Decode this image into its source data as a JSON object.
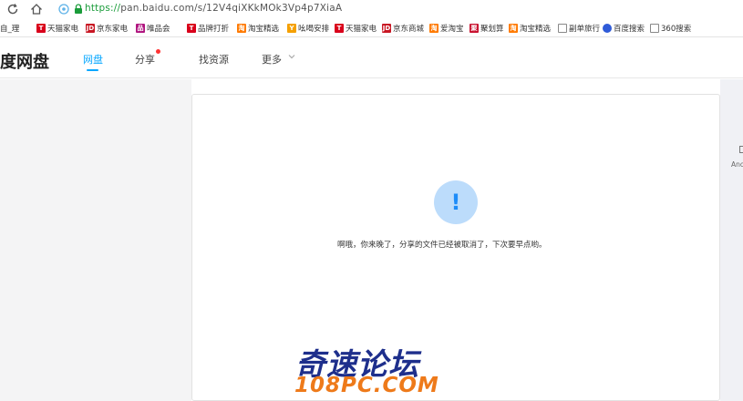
{
  "browser": {
    "url_protocol": "https://",
    "url_rest": "pan.baidu.com/s/12V4qiXKkMOk3Vp4p7XiaA"
  },
  "bookmarks": [
    {
      "label": "自_理",
      "icon": "",
      "color": "#ffffff"
    },
    {
      "label": "天猫家电",
      "icon": "T",
      "color": "#d9001b"
    },
    {
      "label": "京东家电",
      "icon": "JD",
      "color": "#c81623"
    },
    {
      "label": "唯品会",
      "icon": "品",
      "color": "#b0157f"
    },
    {
      "label": "品牌打折",
      "icon": "T",
      "color": "#d9001b"
    },
    {
      "label": "淘宝精选",
      "icon": "淘",
      "color": "#ff7a00"
    },
    {
      "label": "吆喝安排",
      "icon": "Y",
      "color": "#f5a000"
    },
    {
      "label": "天猫家电",
      "icon": "T",
      "color": "#d9001b"
    },
    {
      "label": "京东商城",
      "icon": "JD",
      "color": "#c81623"
    },
    {
      "label": "爱淘宝",
      "icon": "淘",
      "color": "#ff7a00"
    },
    {
      "label": "聚划算",
      "icon": "聚",
      "color": "#c8102e"
    },
    {
      "label": "淘宝精选",
      "icon": "淘",
      "color": "#ff7a00"
    },
    {
      "label": "副单旅行",
      "icon": "",
      "color": "#ffffff"
    },
    {
      "label": "百度搜索",
      "icon": "",
      "color": "#2f5bd8"
    },
    {
      "label": "360搜索",
      "icon": "",
      "color": "#ffffff"
    }
  ],
  "header": {
    "logo": "度网盘",
    "nav": [
      {
        "label": "网盘"
      },
      {
        "label": "分享"
      },
      {
        "label": "找资源"
      },
      {
        "label": "更多"
      }
    ]
  },
  "main": {
    "message": "啊哦，你来晚了，分享的文件已经被取消了，下次要早点哟。",
    "alert_glyph": "!"
  },
  "right_panel": {
    "label": "Anc"
  },
  "watermark": {
    "title": "奇速论坛",
    "subtitle": "108PC.COM"
  },
  "colors": {
    "accent": "#06a7ff",
    "alert_bg": "#bcdcfb",
    "alert_fg": "#1d8cf8",
    "watermark_title": "#1e2f8c",
    "watermark_sub": "#ee7a1a"
  }
}
